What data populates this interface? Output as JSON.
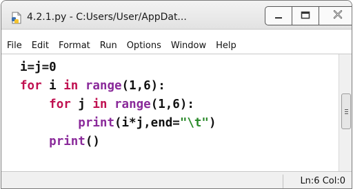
{
  "window": {
    "title": "4.2.1.py - C:Users/User/AppDat...",
    "app_icon": "python-idle-file-icon",
    "controls": {
      "minimize_icon": "minimize-icon",
      "maximize_icon": "maximize-icon",
      "close_icon": "close-icon"
    }
  },
  "menu": {
    "items": [
      "File",
      "Edit",
      "Format",
      "Run",
      "Options",
      "Window",
      "Help"
    ]
  },
  "editor": {
    "lines": [
      [
        {
          "t": "i=j=0",
          "c": "plain"
        }
      ],
      [
        {
          "t": "for",
          "c": "kw"
        },
        {
          "t": " i ",
          "c": "plain"
        },
        {
          "t": "in",
          "c": "kw"
        },
        {
          "t": " ",
          "c": "plain"
        },
        {
          "t": "range",
          "c": "bi"
        },
        {
          "t": "(1,6):",
          "c": "plain"
        }
      ],
      [
        {
          "t": "    ",
          "c": "plain"
        },
        {
          "t": "for",
          "c": "kw"
        },
        {
          "t": " j ",
          "c": "plain"
        },
        {
          "t": "in",
          "c": "kw"
        },
        {
          "t": " ",
          "c": "plain"
        },
        {
          "t": "range",
          "c": "bi"
        },
        {
          "t": "(1,6):",
          "c": "plain"
        }
      ],
      [
        {
          "t": "        ",
          "c": "plain"
        },
        {
          "t": "print",
          "c": "bi"
        },
        {
          "t": "(i*j,end=",
          "c": "plain"
        },
        {
          "t": "\"\\t\"",
          "c": "str"
        },
        {
          "t": ")",
          "c": "plain"
        }
      ],
      [
        {
          "t": "    ",
          "c": "plain"
        },
        {
          "t": "print",
          "c": "bi"
        },
        {
          "t": "()",
          "c": "plain"
        }
      ]
    ],
    "colors": {
      "keyword": "#c01050",
      "builtin": "#8a2a9a",
      "string": "#2a8a2a"
    }
  },
  "status": {
    "position": "Ln:6 Col:0"
  }
}
